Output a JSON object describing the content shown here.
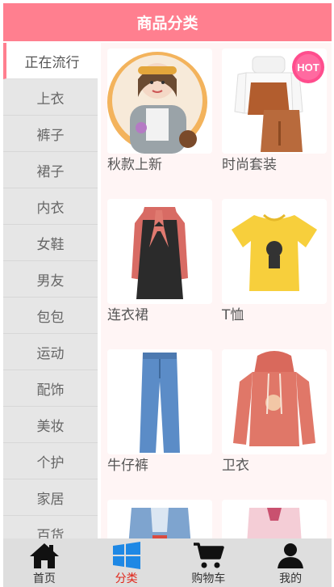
{
  "header": {
    "title": "商品分类"
  },
  "sidebar": {
    "items": [
      {
        "label": "正在流行"
      },
      {
        "label": "上衣"
      },
      {
        "label": "裤子"
      },
      {
        "label": "裙子"
      },
      {
        "label": "内衣"
      },
      {
        "label": "女鞋"
      },
      {
        "label": "男友"
      },
      {
        "label": "包包"
      },
      {
        "label": "运动"
      },
      {
        "label": "配饰"
      },
      {
        "label": "美妆"
      },
      {
        "label": "个护"
      },
      {
        "label": "家居"
      },
      {
        "label": "百货"
      }
    ]
  },
  "products": [
    {
      "label": "秋款上新",
      "icon": "woman-portrait-icon"
    },
    {
      "label": "时尚套装",
      "icon": "outfit-set-icon",
      "badge": "HOT"
    },
    {
      "label": "连衣裙",
      "icon": "dress-icon"
    },
    {
      "label": "T恤",
      "icon": "tshirt-icon"
    },
    {
      "label": "牛仔裤",
      "icon": "jeans-icon"
    },
    {
      "label": "卫衣",
      "icon": "hoodie-icon"
    },
    {
      "label": "",
      "icon": "denim-jacket-icon"
    },
    {
      "label": "",
      "icon": "pink-blouse-icon"
    }
  ],
  "tabbar": {
    "tabs": [
      {
        "label": "首页",
        "icon": "home-icon"
      },
      {
        "label": "分类",
        "icon": "windows-grid-icon",
        "active": true
      },
      {
        "label": "购物车",
        "icon": "cart-icon"
      },
      {
        "label": "我的",
        "icon": "user-icon"
      }
    ]
  },
  "colors": {
    "accent": "#ff7f8f",
    "active_tab": "#e0261a",
    "content_bg": "#fff5f5"
  }
}
